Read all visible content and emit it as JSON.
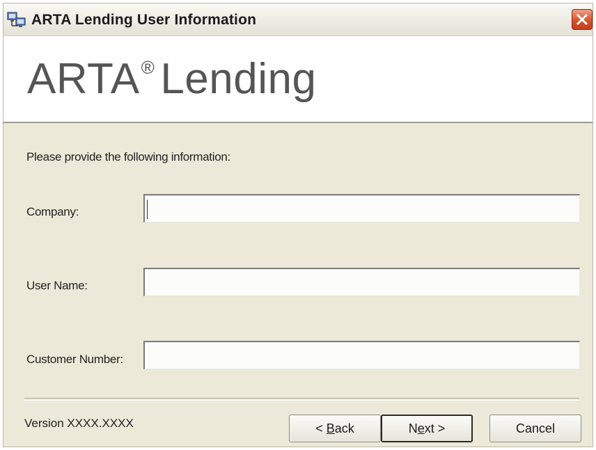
{
  "window": {
    "title": "ARTA Lending User Information"
  },
  "banner": {
    "brand_name": "ARTA",
    "brand_mark": "®",
    "brand_suffix": "Lending"
  },
  "form": {
    "instruction": "Please provide the following information:",
    "fields": [
      {
        "label": "Company:",
        "value": ""
      },
      {
        "label": "User Name:",
        "value": ""
      },
      {
        "label": "Customer Number:",
        "value": ""
      }
    ]
  },
  "footer": {
    "version": "Version XXXX.XXXX",
    "buttons": {
      "back_prefix": "< ",
      "back_key": "B",
      "back_rest": "ack",
      "next_prefix": "N",
      "next_key": "e",
      "next_rest": "xt >",
      "cancel": "Cancel"
    }
  },
  "icons": {
    "title_icon": "computer-network-icon",
    "close": "close-icon"
  },
  "colors": {
    "window_bg": "#ece9d8",
    "close_red": "#d8512d"
  }
}
